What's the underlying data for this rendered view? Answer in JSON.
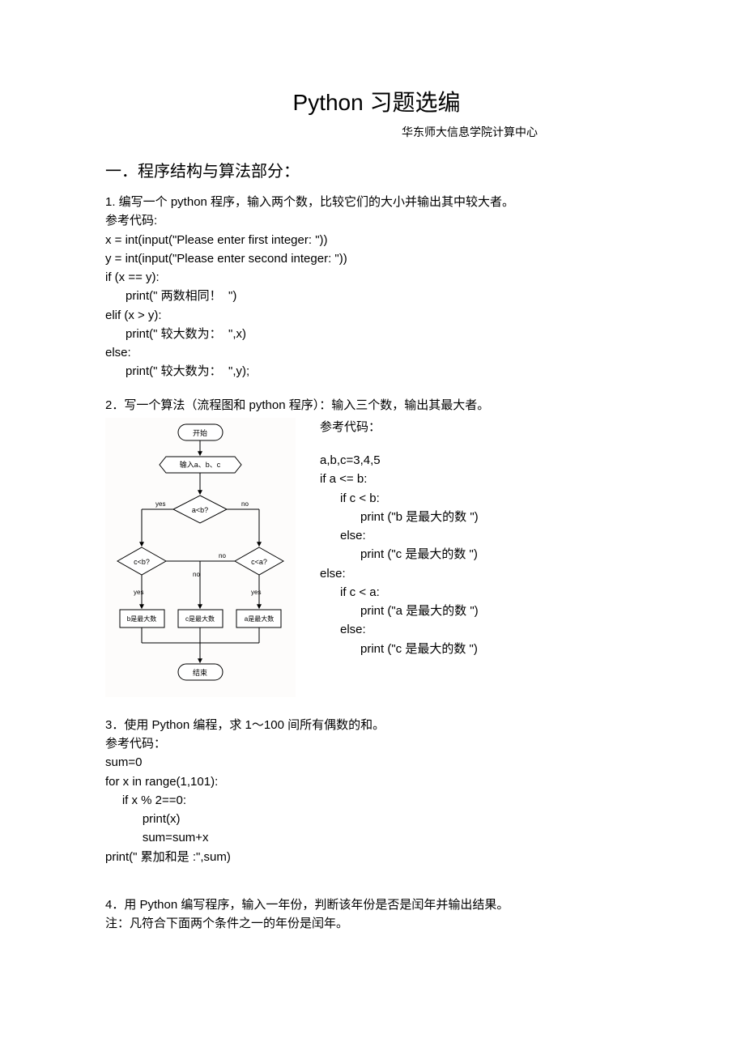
{
  "title": "Python 习题选编",
  "subtitle": "华东师大信息学院计算中心",
  "section1": "一．程序结构与算法部分：",
  "q1": {
    "prompt": "1. 编写一个  python 程序，输入两个数，比较它们的大小并输出其中较大者。",
    "ref": "参考代码:",
    "code": "x = int(input(\"Please enter first integer: \"))\ny = int(input(\"Please enter second integer: \"))\nif (x == y):\n      print(\" 两数相同！  \")\nelif (x > y):\n      print(\" 较大数为：  \",x)\nelse:\n      print(\" 较大数为：  \",y);"
  },
  "q2": {
    "prompt": "2．写一个算法（流程图和    python 程序）：输入三个数，输出其最大者。",
    "ref": "参考代码：",
    "code": "a,b,c=3,4,5\nif a <= b:\n      if c < b:\n            print (\"b 是最大的数 \")\n      else:\n            print (\"c 是最大的数 \")\nelse:\n      if c < a:\n            print (\"a 是最大的数 \")\n      else:\n            print (\"c 是最大的数 \")"
  },
  "q3": {
    "prompt": "3．使用 Python 编程，求  1～100 间所有偶数的和。",
    "ref": "参考代码：",
    "code": "sum=0\nfor x in range(1,101):\n     if x % 2==0:\n           print(x)\n           sum=sum+x\nprint(\" 累加和是 :\",sum)"
  },
  "q4": {
    "prompt": "4．用 Python 编写程序，输入一年份，判断该年份是否是闰年并输出结果。",
    "note": "注：凡符合下面两个条件之一的年份是闰年。"
  },
  "flowchart": {
    "start": "开始",
    "input": "输入a、b、c",
    "cond_ab": "a<b?",
    "cond_cb": "c<b?",
    "cond_ca": "c<a?",
    "yes": "yes",
    "no": "no",
    "bmax": "b是最大数",
    "cmax": "c是最大数",
    "amax": "a是最大数",
    "end": "结束"
  }
}
